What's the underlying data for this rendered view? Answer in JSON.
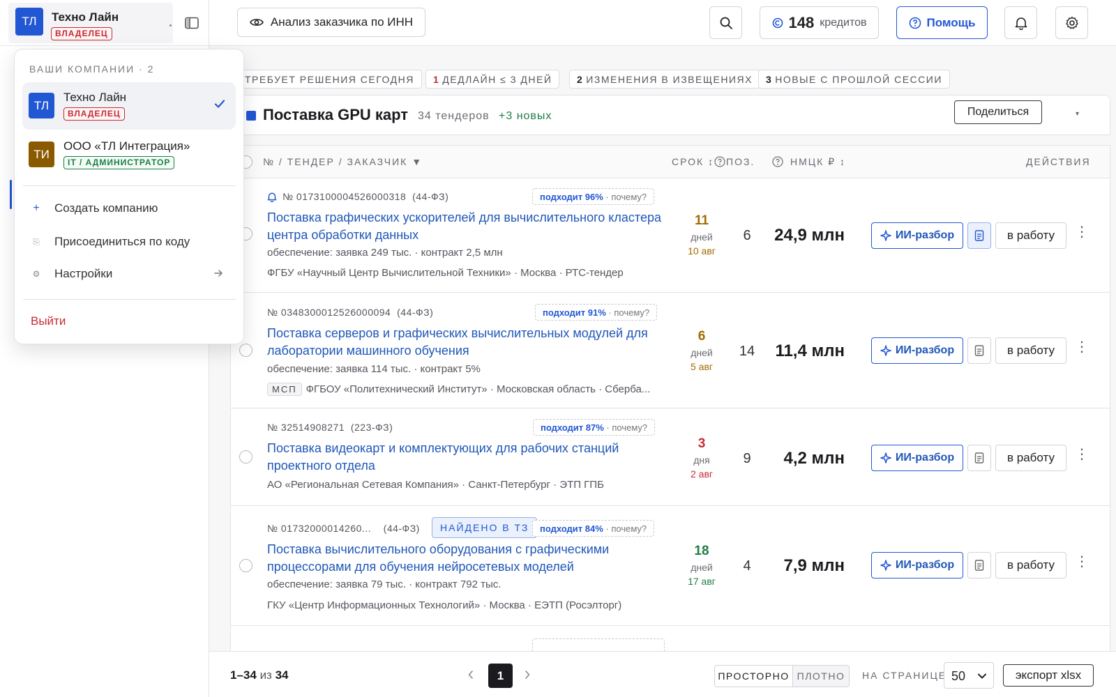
{
  "sidebar": {
    "company": {
      "initials": "ТЛ",
      "name": "Техно Лайн",
      "role": "ВЛАДЕЛЕЦ"
    }
  },
  "dropdown": {
    "title": "ВАШИ КОМПАНИИ · 2",
    "companies": [
      {
        "initials": "ТЛ",
        "name": "Техно Лайн",
        "role": "ВЛАДЕЛЕЦ",
        "selected": true
      },
      {
        "initials": "ТИ",
        "name": "ООО «ТЛ Интеграция»",
        "role": "IT / АДМИНИСТРАТОР",
        "selected": false
      }
    ],
    "actions": [
      {
        "icon": "+",
        "label": "Создать компанию"
      },
      {
        "icon": "⎘",
        "label": "Присоединиться по коду"
      },
      {
        "icon": "⚙",
        "label": "Настройки"
      }
    ],
    "logout": "Выйти"
  },
  "topbar": {
    "inn_button": "Анализ заказчика по ИНН",
    "credits_value": "148",
    "credits_label": "кредитов",
    "help": "Помощь"
  },
  "chips": [
    {
      "count": "",
      "label": "ТРЕБУЕТ РЕШЕНИЯ СЕГОДНЯ"
    },
    {
      "count": "1",
      "label": "ДЕДЛАЙН ≤ 3 ДНЕЙ"
    },
    {
      "count": "2",
      "label": "ИЗМЕНЕНИЯ В ИЗВЕЩЕНИЯХ"
    },
    {
      "count": "3",
      "label": "НОВЫЕ С ПРОШЛОЙ СЕССИИ"
    }
  ],
  "collection": {
    "title": "Поставка GPU карт",
    "count": "34 тендеров",
    "new": "+3 новых",
    "share": "Поделиться"
  },
  "table": {
    "headers": {
      "tender": "№ / ТЕНДЕР / ЗАКАЗЧИК ▼",
      "deadline": "СРОК ↕",
      "positions": "ПОЗ.",
      "nmck": "НМЦК ₽ ↕",
      "actions": "ДЕЙСТВИЯ"
    },
    "ai_label": "ИИ-разбор",
    "work_label": "в работу",
    "why": "почему?",
    "rows": [
      {
        "number": "№ 0173100004526000318",
        "law": "(44-ФЗ)",
        "fit": "подходит 96%",
        "title": "Поставка графических ускорителей для вычислительного кластера центра обработки данных",
        "security": "обеспечение: заявка 249 тыс. · контракт 2,5 млн",
        "msp": "",
        "org": "ФГБУ «Научный Центр Вычислительной Техники» · Москва · РТС-тендер",
        "days": "11",
        "days_unit": "дней",
        "date": "10 авг",
        "urgency": "amber",
        "positions": "6",
        "nmck": "24,9 млн",
        "tz": "",
        "bell": true,
        "doc_on": true
      },
      {
        "number": "№ 0348300012526000094",
        "law": "(44-ФЗ)",
        "fit": "подходит 91%",
        "title": "Поставка серверов и графических вычислительных модулей для лаборатории машинного обучения",
        "security": "обеспечение: заявка 114 тыс. · контракт 5%",
        "msp": "МСП",
        "org": "ФГБОУ «Политехнический Институт» · Московская область · Сберба...",
        "days": "6",
        "days_unit": "дней",
        "date": "5 авг",
        "urgency": "amber",
        "positions": "14",
        "nmck": "11,4 млн",
        "tz": "",
        "bell": false,
        "doc_on": false
      },
      {
        "number": "№ 32514908271",
        "law": "(223-ФЗ)",
        "fit": "подходит 87%",
        "title": "Поставка видеокарт и комплектующих для рабочих станций проектного отдела",
        "security": "",
        "msp": "",
        "org": "АО «Региональная Сетевая Компания» · Санкт-Петербург · ЭТП ГПБ",
        "days": "3",
        "days_unit": "дня",
        "date": "2 авг",
        "urgency": "red",
        "positions": "9",
        "nmck": "4,2 млн",
        "tz": "",
        "bell": false,
        "doc_on": false
      },
      {
        "number": "№ 01732000014260...",
        "law": "(44-ФЗ)",
        "fit": "подходит 84%",
        "title": "Поставка вычислительного оборудования с графическими процессорами для обучения нейросетевых моделей",
        "security": "обеспечение: заявка 79 тыс. · контракт 792 тыс.",
        "msp": "",
        "org": "ГКУ «Центр Информационных Технологий» · Москва · ЕЭТП (Росэлторг)",
        "days": "18",
        "days_unit": "дней",
        "date": "17 авг",
        "urgency": "green",
        "positions": "4",
        "nmck": "7,9 млн",
        "tz": "НАЙДЕНО В ТЗ",
        "bell": false,
        "doc_on": false
      }
    ]
  },
  "footer": {
    "range": "1–34",
    "of": "из",
    "total": "34",
    "page": "1",
    "density_spacious": "ПРОСТОРНО",
    "density_compact": "ПЛОТНО",
    "per_page_label": "НА СТРАНИЦЕ",
    "per_page": "50",
    "export": "экспорт xlsx"
  },
  "colors": {
    "accent": "#2257d4",
    "danger": "#c62a32",
    "success": "#1e7d45",
    "warning": "#a56a00"
  }
}
